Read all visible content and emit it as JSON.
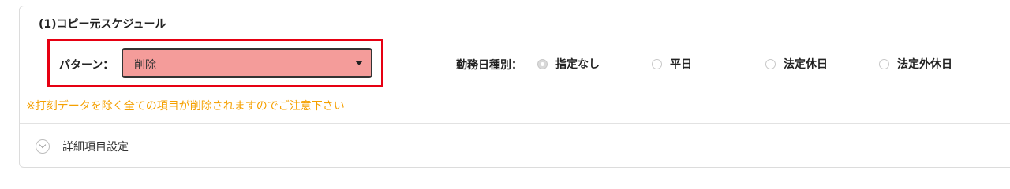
{
  "section": {
    "title": "(1)コピー元スケジュール"
  },
  "pattern": {
    "label": "パターン：",
    "selected": "削除"
  },
  "work_type": {
    "label": "勤務日種別：",
    "options": [
      {
        "label": "指定なし",
        "checked": true
      },
      {
        "label": "平日",
        "checked": false
      },
      {
        "label": "法定休日",
        "checked": false
      },
      {
        "label": "法定外休日",
        "checked": false
      }
    ]
  },
  "warning": {
    "text": "※打刻データを除く全ての項目が削除されますのでご注意下さい"
  },
  "details": {
    "label": "詳細項目設定"
  },
  "colors": {
    "highlight_border": "#e60012",
    "select_bg": "#f49c9a",
    "warning_text": "#f5a000"
  }
}
